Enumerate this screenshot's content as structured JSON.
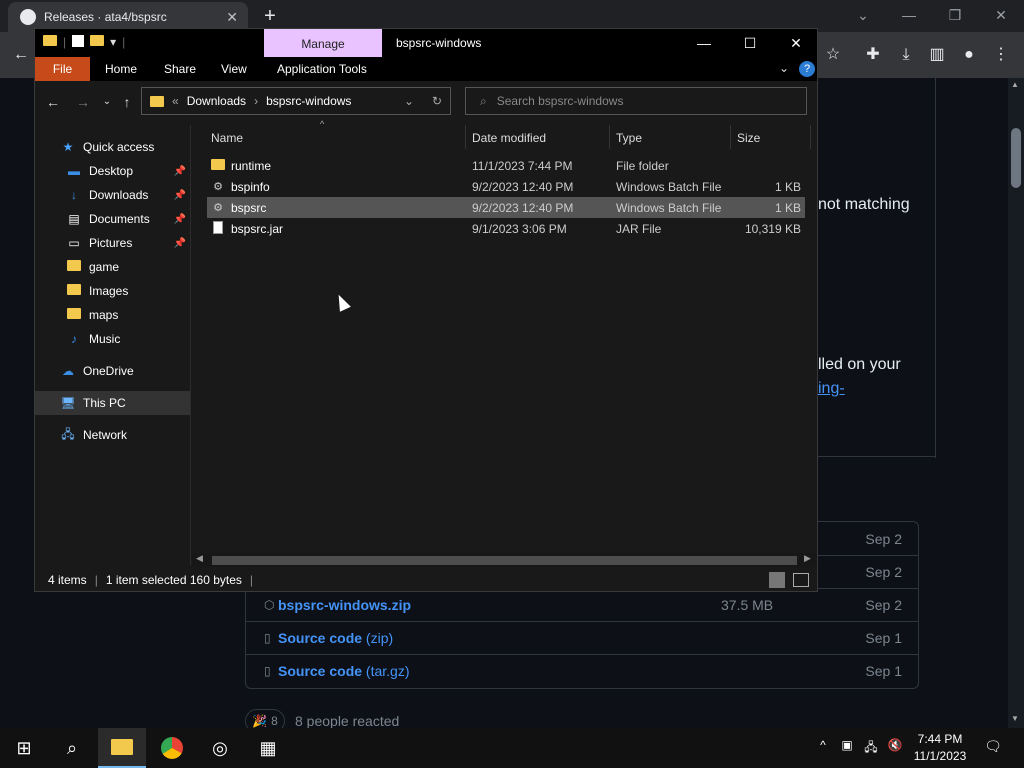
{
  "browser": {
    "tab_title": "Releases · ata4/bspsrc",
    "new_tab_label": "+",
    "win_minimize": "—",
    "win_restore": "❐",
    "win_close": "✕",
    "win_dropdown": "⌄"
  },
  "github": {
    "text_line1": "not matching",
    "text_line2": "lled on your",
    "link_text": "ing-",
    "assets": [
      {
        "icon": "package-icon",
        "name": "bspsrc-windows.zip",
        "suffix": "",
        "size": "37.5 MB",
        "date": "Sep 2"
      },
      {
        "icon": "zip-icon",
        "name": "Source code",
        "suffix": "(zip)",
        "size": "",
        "date": "Sep 1"
      },
      {
        "icon": "zip-icon",
        "name": "Source code",
        "suffix": "(tar.gz)",
        "size": "",
        "date": "Sep 1"
      }
    ],
    "asset_dates_hidden": [
      "Sep 2",
      "Sep 2"
    ],
    "reaction_count": "8",
    "reactions_text": "8 people reacted"
  },
  "explorer": {
    "manage_label": "Manage",
    "title": "bspsrc-windows",
    "ribbon_tabs": [
      "File",
      "Home",
      "Share",
      "View",
      "Application Tools"
    ],
    "breadcrumb": [
      "«",
      "Downloads",
      "›",
      "bspsrc-windows"
    ],
    "search_placeholder": "Search bspsrc-windows",
    "nav": [
      {
        "label": "Quick access",
        "icon": "star-icon",
        "pinned": false
      },
      {
        "label": "Desktop",
        "icon": "desktop-icon",
        "pinned": true
      },
      {
        "label": "Downloads",
        "icon": "download-icon",
        "pinned": true
      },
      {
        "label": "Documents",
        "icon": "documents-icon",
        "pinned": true
      },
      {
        "label": "Pictures",
        "icon": "pictures-icon",
        "pinned": true
      },
      {
        "label": "game",
        "icon": "folder-icon",
        "pinned": false
      },
      {
        "label": "Images",
        "icon": "folder-icon",
        "pinned": false
      },
      {
        "label": "maps",
        "icon": "folder-icon",
        "pinned": false
      },
      {
        "label": "Music",
        "icon": "music-icon",
        "pinned": false
      },
      {
        "label": "OneDrive",
        "icon": "cloud-icon",
        "pinned": false
      },
      {
        "label": "This PC",
        "icon": "computer-icon",
        "pinned": false
      },
      {
        "label": "Network",
        "icon": "network-icon",
        "pinned": false
      }
    ],
    "columns": [
      "Name",
      "Date modified",
      "Type",
      "Size"
    ],
    "files": [
      {
        "name": "runtime",
        "date": "11/1/2023 7:44 PM",
        "type": "File folder",
        "size": "",
        "kind": "folder",
        "selected": false
      },
      {
        "name": "bspinfo",
        "date": "9/2/2023 12:40 PM",
        "type": "Windows Batch File",
        "size": "1 KB",
        "kind": "batch",
        "selected": false
      },
      {
        "name": "bspsrc",
        "date": "9/2/2023 12:40 PM",
        "type": "Windows Batch File",
        "size": "1 KB",
        "kind": "batch",
        "selected": true
      },
      {
        "name": "bspsrc.jar",
        "date": "9/1/2023 3:06 PM",
        "type": "JAR File",
        "size": "10,319 KB",
        "kind": "file",
        "selected": false
      }
    ],
    "status": {
      "items": "4 items",
      "selected": "1 item selected  160 bytes"
    }
  },
  "taskbar": {
    "time": "7:44 PM",
    "date": "11/1/2023"
  }
}
